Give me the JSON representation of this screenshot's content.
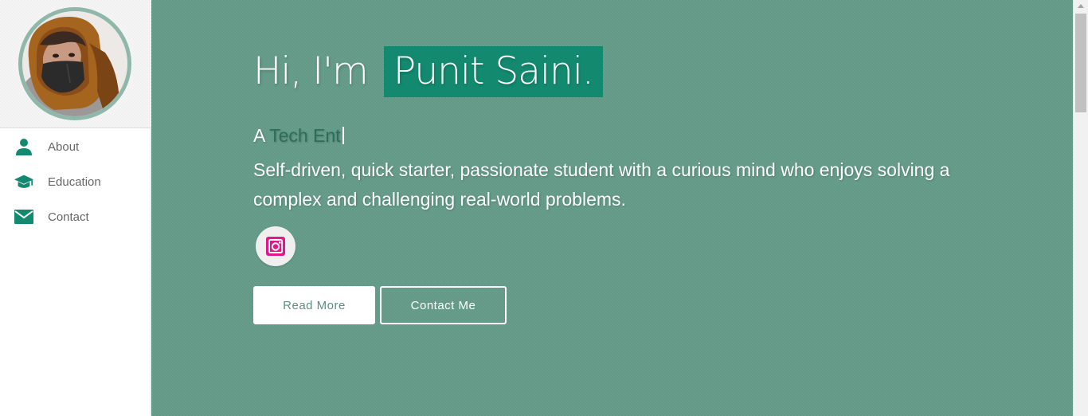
{
  "sidebar": {
    "avatar_alt": "Profile photo",
    "items": [
      {
        "label": "About",
        "icon": "person-icon"
      },
      {
        "label": "Education",
        "icon": "graduation-cap-icon"
      },
      {
        "label": "Contact",
        "icon": "envelope-icon"
      }
    ]
  },
  "hero": {
    "greeting_prefix": "Hi, I'm",
    "name": "Punit Saini.",
    "typed_prefix": "A",
    "typed_text": "Tech Ent",
    "bio": "Self-driven, quick starter, passionate student with a curious mind who enjoys solving a complex and challenging real-world problems.",
    "social": [
      {
        "name": "instagram",
        "icon": "instagram-icon"
      }
    ],
    "buttons": {
      "read_more": "Read More",
      "contact_me": "Contact Me"
    }
  },
  "colors": {
    "accent": "#138a6f",
    "hero_background": "#679e8c",
    "nav_icon": "#138a6f",
    "avatar_ring": "#8fb8ab",
    "instagram": "#e1178c"
  }
}
